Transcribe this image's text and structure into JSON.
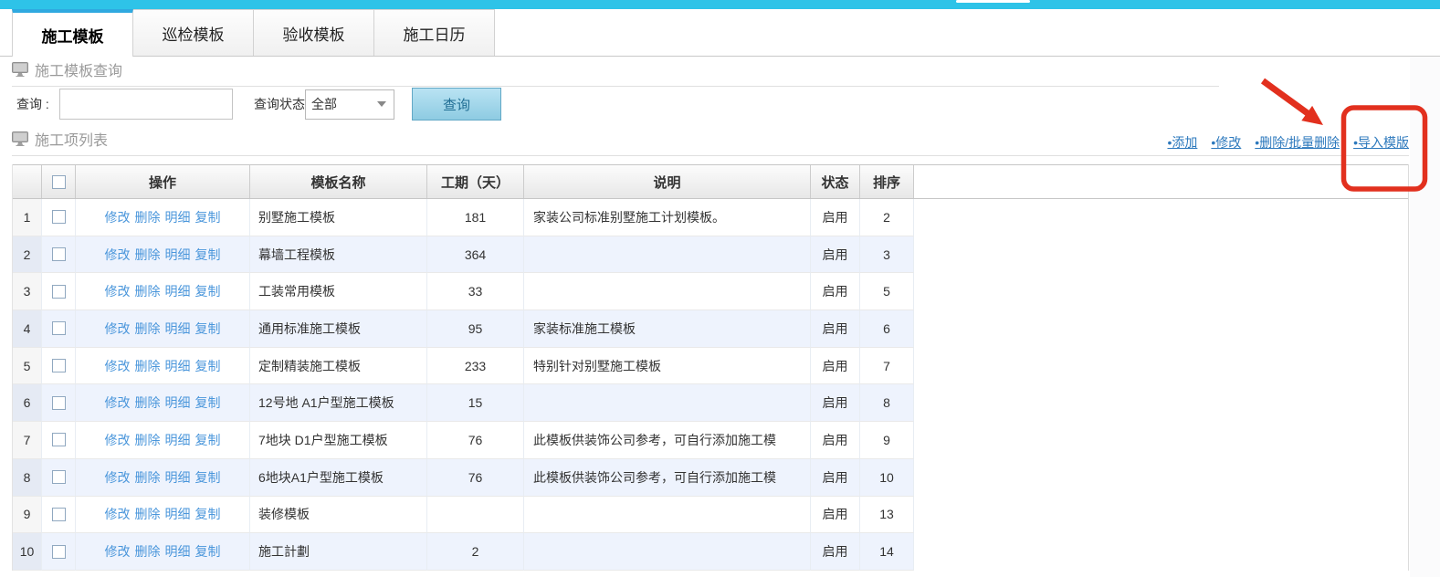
{
  "tabs": [
    {
      "label": "施工模板",
      "active": true
    },
    {
      "label": "巡检模板",
      "active": false
    },
    {
      "label": "验收模板",
      "active": false
    },
    {
      "label": "施工日历",
      "active": false
    }
  ],
  "query_section": {
    "title": "施工模板查询",
    "query_label": "查询 :",
    "input_value": "",
    "status_label": "查询状态",
    "status_value": "全部",
    "search_button": "查询"
  },
  "list_section": {
    "title": "施工项列表",
    "toolbar_links": [
      "•添加",
      "•修改",
      "•删除/批量删除",
      "•导入模版"
    ]
  },
  "table": {
    "headers": [
      "操作",
      "模板名称",
      "工期（天）",
      "说明",
      "状态",
      "排序"
    ],
    "action_links": [
      "修改",
      "删除",
      "明细",
      "复制"
    ],
    "rows": [
      {
        "num": "1",
        "name": "别墅施工模板",
        "duration": "181",
        "desc": "家装公司标准别墅施工计划模板。",
        "status": "启用",
        "order": "2"
      },
      {
        "num": "2",
        "name": "幕墙工程模板",
        "duration": "364",
        "desc": "",
        "status": "启用",
        "order": "3"
      },
      {
        "num": "3",
        "name": "工装常用模板",
        "duration": "33",
        "desc": "",
        "status": "启用",
        "order": "5"
      },
      {
        "num": "4",
        "name": "通用标准施工模板",
        "duration": "95",
        "desc": "家装标准施工模板",
        "status": "启用",
        "order": "6"
      },
      {
        "num": "5",
        "name": "定制精装施工模板",
        "duration": "233",
        "desc": "特别针对别墅施工模板",
        "status": "启用",
        "order": "7"
      },
      {
        "num": "6",
        "name": "12号地 A1户型施工模板",
        "duration": "15",
        "desc": "",
        "status": "启用",
        "order": "8"
      },
      {
        "num": "7",
        "name": "7地块 D1户型施工模板",
        "duration": "76",
        "desc": "此模板供装饰公司参考，可自行添加施工模",
        "status": "启用",
        "order": "9"
      },
      {
        "num": "8",
        "name": "6地块A1户型施工模板",
        "duration": "76",
        "desc": "此模板供装饰公司参考，可自行添加施工模",
        "status": "启用",
        "order": "10"
      },
      {
        "num": "9",
        "name": "装修模板",
        "duration": "",
        "desc": "",
        "status": "启用",
        "order": "13"
      },
      {
        "num": "10",
        "name": "施工計劃",
        "duration": "2",
        "desc": "",
        "status": "启用",
        "order": "14"
      }
    ]
  },
  "annotation": {
    "highlight_target": "导入模版",
    "arrow_color": "#e2301e",
    "box_color": "#e2301e"
  },
  "colors": {
    "top_accent": "#2ec3e8",
    "active_tab_accent": "#2fa9e0",
    "link_blue": "#2d79bd",
    "action_link_blue": "#4a96db",
    "stripe_blue": "#eef3fd",
    "button_face": "#9fd4ea",
    "button_border": "#62a8c6"
  }
}
